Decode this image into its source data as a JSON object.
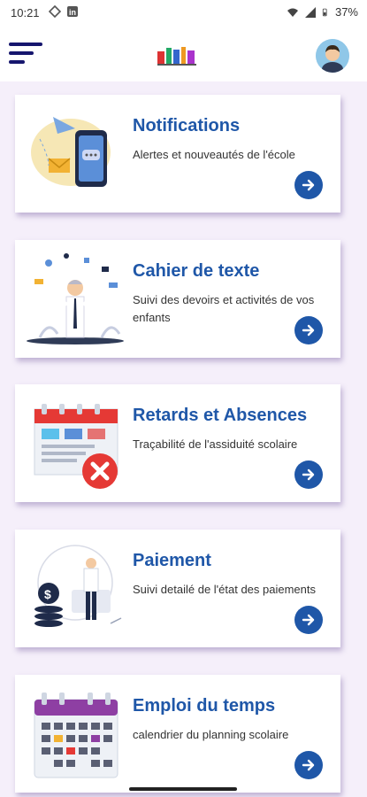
{
  "status_bar": {
    "time": "10:21",
    "battery": "37%",
    "icons": [
      "location-icon",
      "linkedin-icon",
      "wifi-icon",
      "signal-icon",
      "battery-icon"
    ]
  },
  "header": {
    "menu_icon": "hamburger-menu-icon",
    "logo": "app-logo",
    "avatar": "user-avatar"
  },
  "cards": [
    {
      "title": "Notifications",
      "description": "Alertes et nouveautés de l'école",
      "icon": "notifications-illustration"
    },
    {
      "title": "Cahier de texte",
      "description": "Suivi des devoirs et activités de vos enfants",
      "icon": "homework-illustration"
    },
    {
      "title": "Retards et Absences",
      "description": "Traçabilité de l'assiduité scolaire",
      "icon": "absence-calendar-illustration"
    },
    {
      "title": "Paiement",
      "description": "Suivi detailé de l'état des paiements",
      "icon": "payment-illustration"
    },
    {
      "title": "Emploi du temps",
      "description": "calendrier du planning scolaire",
      "icon": "timetable-illustration"
    }
  ],
  "colors": {
    "accent": "#1f57a8",
    "menu": "#16166e",
    "background": "#f5effa"
  }
}
